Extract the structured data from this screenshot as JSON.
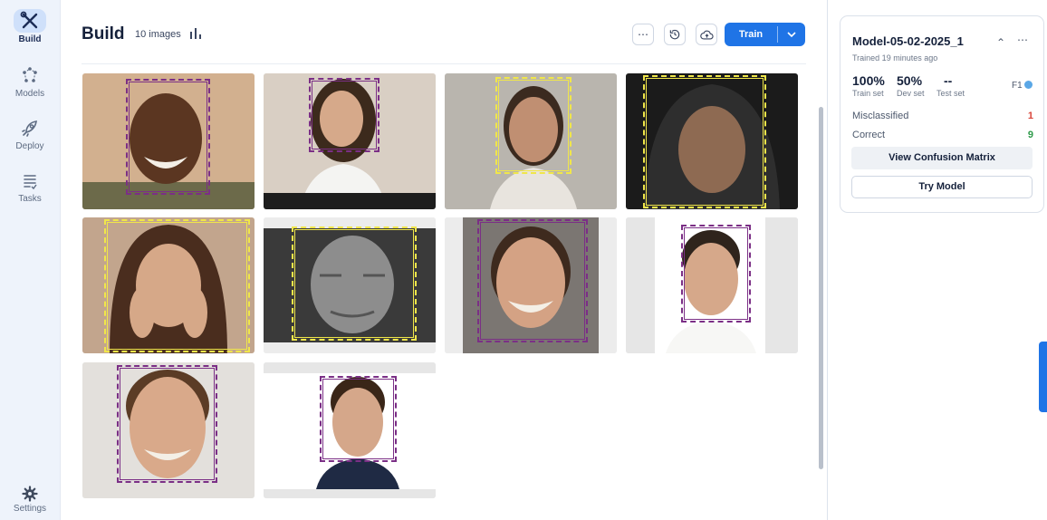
{
  "nav": {
    "items": [
      {
        "label": "Build",
        "icon": "tools-icon",
        "active": true
      },
      {
        "label": "Models",
        "icon": "network-icon",
        "active": false
      },
      {
        "label": "Deploy",
        "icon": "rocket-icon",
        "active": false
      },
      {
        "label": "Tasks",
        "icon": "task-list-icon",
        "active": false
      }
    ],
    "settings_label": "Settings"
  },
  "header": {
    "title": "Build",
    "count": "10 images",
    "train_label": "Train",
    "accent_color": "#1f74e6"
  },
  "images": [
    {
      "label_color": "purple"
    },
    {
      "label_color": "purple"
    },
    {
      "label_color": "yellow"
    },
    {
      "label_color": "yellow"
    },
    {
      "label_color": "yellow"
    },
    {
      "label_color": "yellow"
    },
    {
      "label_color": "purple"
    },
    {
      "label_color": "purple"
    },
    {
      "label_color": "purple"
    },
    {
      "label_color": "purple"
    }
  ],
  "model": {
    "name": "Model-05-02-2025_1",
    "trained": "Trained 19 minutes ago",
    "train_value": "100%",
    "train_label": "Train set",
    "dev_value": "50%",
    "dev_label": "Dev set",
    "test_value": "--",
    "test_label": "Test set",
    "metric_label": "F1",
    "misclassified_label": "Misclassified",
    "misclassified_count": "1",
    "correct_label": "Correct",
    "correct_count": "9",
    "confusion_button": "View Confusion Matrix",
    "try_button": "Try Model"
  },
  "colors": {
    "purple_box": "#7b2f86",
    "yellow_box": "#f0e64a",
    "misclassified": "#d9463b",
    "correct": "#2e9a4a"
  }
}
